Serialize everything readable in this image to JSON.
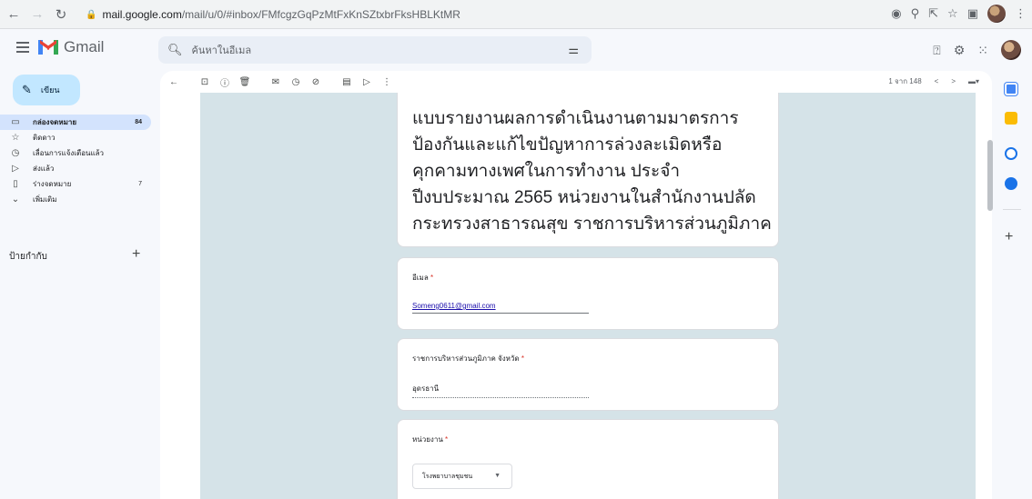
{
  "browser": {
    "url_host": "mail.google.com",
    "url_path": "/mail/u/0/#inbox/FMfcgzGqPzMtFxKnSZtxbrFksHBLKtMR"
  },
  "gmail": {
    "logo_text": "Gmail",
    "search_placeholder": "ค้นหาในอีเมล",
    "compose_label": "เขียน",
    "nav": [
      {
        "label": "กล่องจดหมาย",
        "count": "84",
        "icon": "inbox-icon"
      },
      {
        "label": "ติดดาว",
        "count": "",
        "icon": "star-icon"
      },
      {
        "label": "เลื่อนการแจ้งเตือนแล้ว",
        "count": "",
        "icon": "clock-icon"
      },
      {
        "label": "ส่งแล้ว",
        "count": "",
        "icon": "send-icon"
      },
      {
        "label": "ร่างจดหมาย",
        "count": "7",
        "icon": "draft-icon"
      },
      {
        "label": "เพิ่มเติม",
        "count": "",
        "icon": "chevron-down-icon"
      }
    ],
    "labels_title": "ป้ายกำกับ",
    "pager_text": "1 จาก 148"
  },
  "form": {
    "title": "แบบรายงานผลการดำเนินงานตามมาตรการป้องกันและแก้ไขปัญหาการล่วงละเมิดหรือคุกคามทางเพศในการทำงาน ประจำปีงบประมาณ 2565 หน่วยงานในสำนักงานปลัดกระทรวงสาธารณสุข ราชการบริหารส่วนภูมิภาค",
    "questions": [
      {
        "label": "อีเมล",
        "required": "*",
        "value": "Someng0611@gmail.com"
      },
      {
        "label": "ราชการบริหารส่วนภูมิภาค จังหวัด",
        "required": "*",
        "value": "อุดรธานี"
      },
      {
        "label": "หน่วยงาน",
        "required": "*",
        "value": "โรงพยาบาลชุมชน"
      }
    ]
  }
}
